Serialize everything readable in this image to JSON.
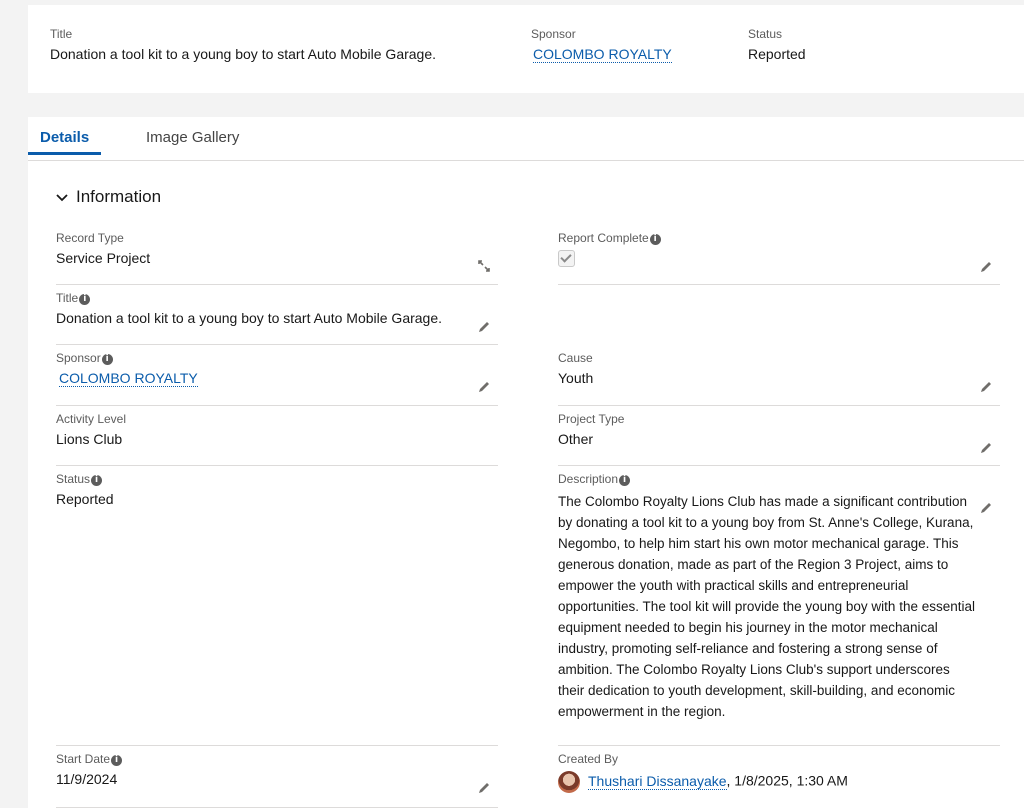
{
  "header": {
    "title_label": "Title",
    "title_value": "Donation a tool kit to a young boy to start Auto Mobile Garage.",
    "sponsor_label": "Sponsor",
    "sponsor_value": "COLOMBO ROYALTY",
    "status_label": "Status",
    "status_value": "Reported"
  },
  "tabs": [
    {
      "label": "Details",
      "active": true
    },
    {
      "label": "Image Gallery",
      "active": false
    }
  ],
  "section": {
    "title": "Information"
  },
  "fields": {
    "record_type": {
      "label": "Record Type",
      "value": "Service Project"
    },
    "report_complete": {
      "label": "Report Complete",
      "checked": true
    },
    "title": {
      "label": "Title",
      "value": "Donation a tool kit to a young boy to start Auto Mobile Garage."
    },
    "sponsor": {
      "label": "Sponsor",
      "value": "COLOMBO ROYALTY"
    },
    "cause": {
      "label": "Cause",
      "value": "Youth"
    },
    "activity_level": {
      "label": "Activity Level",
      "value": "Lions Club"
    },
    "project_type": {
      "label": "Project Type",
      "value": "Other"
    },
    "status": {
      "label": "Status",
      "value": "Reported"
    },
    "description": {
      "label": "Description",
      "value": "The Colombo Royalty Lions Club has made a significant contribution by donating a tool kit to a young boy from St. Anne's College, Kurana, Negombo, to help him start his own motor mechanical garage. This generous donation, made as part of the Region 3 Project, aims to empower the youth with practical skills and entrepreneurial opportunities. The tool kit will provide the young boy with the essential equipment needed to begin his journey in the motor mechanical industry, promoting self-reliance and fostering a strong sense of ambition. The Colombo Royalty Lions Club's support underscores their dedication to youth development, skill-building, and economic empowerment in the region."
    },
    "start_date": {
      "label": "Start Date",
      "value": "11/9/2024"
    },
    "created_by": {
      "label": "Created By",
      "user": "Thushari Dissanayake",
      "date": ", 1/8/2025, 1:30 AM"
    }
  },
  "icons": {
    "edit": "pencil-icon",
    "change_record_type": "swap-icon",
    "info": "info-icon",
    "section_toggle": "chevron-down-icon"
  },
  "colors": {
    "link": "#0b5cab",
    "accent": "#0b5cab"
  }
}
